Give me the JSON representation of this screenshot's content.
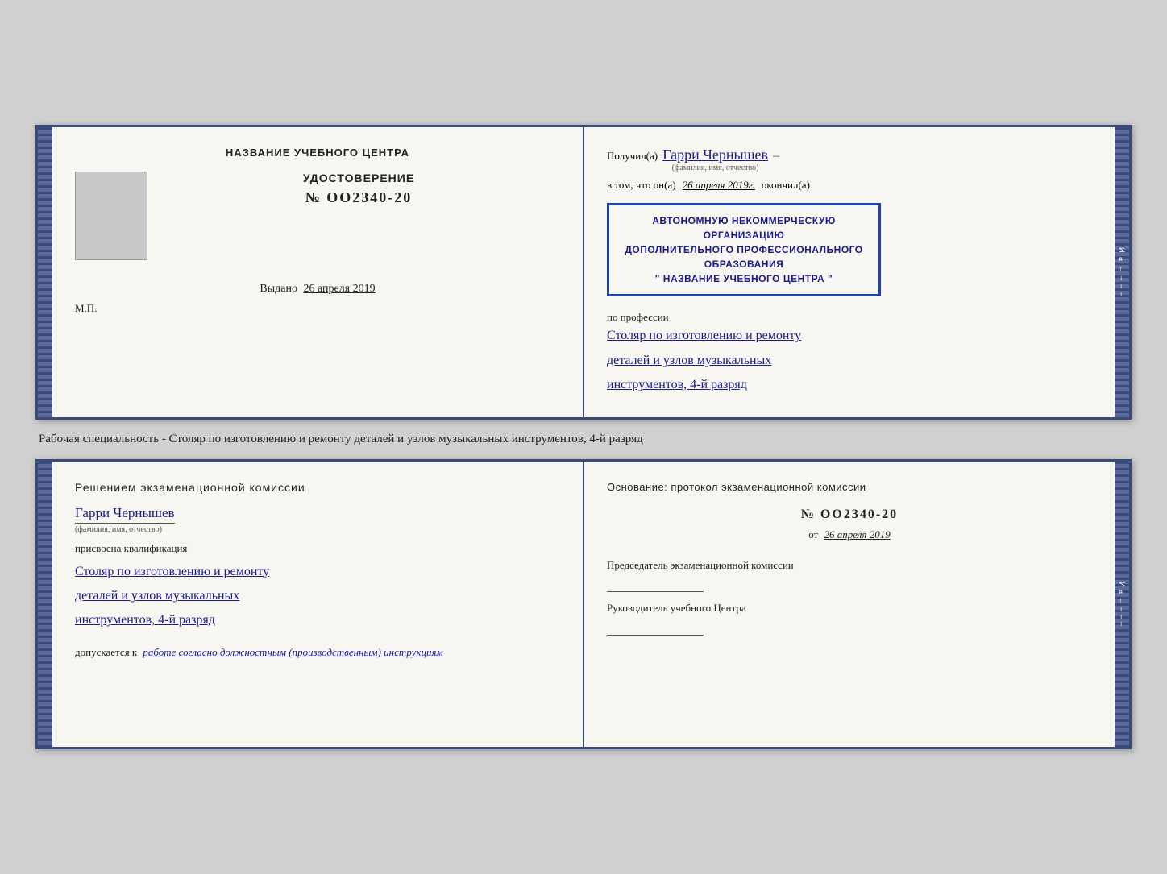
{
  "top_doc": {
    "left": {
      "center_title": "НАЗВАНИЕ УЧЕБНОГО ЦЕНТРА",
      "photo_alt": "фото",
      "cert_title": "УДОСТОВЕРЕНИЕ",
      "cert_number": "№ OO2340-20",
      "issued_label": "Выдано",
      "issued_date": "26 апреля 2019",
      "mp_label": "М.П."
    },
    "right": {
      "received_prefix": "Получил(а)",
      "name": "Гарри Чернышев",
      "fio_label": "(фамилия, имя, отчество)",
      "dash": "–",
      "vtom_prefix": "в том, что он(а)",
      "vtom_date": "26 апреля 2019г.",
      "okончил": "окончил(а)",
      "stamp_line1": "АВТОНОМНУЮ НЕКОММЕРЧЕСКУЮ ОРГАНИЗАЦИЮ",
      "stamp_line2": "ДОПОЛНИТЕЛЬНОГО ПРОФЕССИОНАЛЬНОГО ОБРАЗОВАНИЯ",
      "stamp_line3": "\" НАЗВАНИЕ УЧЕБНОГО ЦЕНТРА \"",
      "profession_label": "по профессии",
      "profession_line1": "Столяр по изготовлению и ремонту",
      "profession_line2": "деталей и узлов музыкальных",
      "profession_line3": "инструментов, 4-й разряд"
    }
  },
  "specialty_label": "Рабочая специальность - Столяр по изготовлению и ремонту деталей и узлов музыкальных инструментов, 4-й разряд",
  "bottom_doc": {
    "left": {
      "decision_title": "Решением  экзаменационной  комиссии",
      "name": "Гарри Чернышев",
      "fio_label": "(фамилия, имя, отчество)",
      "assigned_label": "присвоена квалификация",
      "qualification_line1": "Столяр по изготовлению и ремонту",
      "qualification_line2": "деталей и узлов музыкальных",
      "qualification_line3": "инструментов, 4-й разряд",
      "allow_prefix": "допускается к",
      "allow_text": "работе согласно должностным (производственным) инструкциям"
    },
    "right": {
      "basis_title": "Основание: протокол экзаменационной  комиссии",
      "number": "№  OO2340-20",
      "date_prefix": "от",
      "date_val": "26 апреля 2019",
      "chairman_title": "Председатель экзаменационной комиссии",
      "director_title": "Руководитель учебного Центра"
    }
  },
  "spine_chars": [
    "И",
    "а",
    "←",
    "–",
    "–",
    "–"
  ]
}
